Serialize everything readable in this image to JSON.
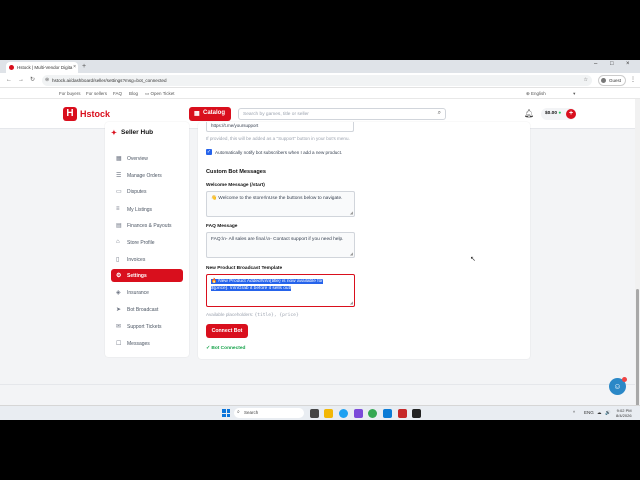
{
  "browser": {
    "tab_title": "Hstock | Multi-Vendor Digita",
    "tab_close": "×",
    "new_tab": "+",
    "window_controls": [
      "–",
      "□",
      "×"
    ],
    "url": "hstock.ai/dashboard/seller/settings?msg=bot_connected",
    "profile": "Guest",
    "bookmarks": [
      "For buyers",
      "For sellers",
      "FAQ",
      "Blog",
      "Open Ticket"
    ],
    "language": "English"
  },
  "header": {
    "logo_mark": "H",
    "logo_text": "Hstock",
    "catalog_label": "Catalog",
    "search_placeholder": "Search by games, title or seller",
    "wallet_amount": "$0.00",
    "wallet_plus": "+"
  },
  "sidebar": {
    "title": "Seller Hub",
    "items": [
      {
        "label": "Overview",
        "icon": "grid-icon"
      },
      {
        "label": "Manage Orders",
        "icon": "orders-icon"
      },
      {
        "label": "Disputes",
        "icon": "disputes-icon"
      },
      {
        "label": "My Listings",
        "icon": "listings-icon"
      },
      {
        "label": "Finances & Payouts",
        "icon": "finance-icon"
      },
      {
        "label": "Store Profile",
        "icon": "store-icon"
      },
      {
        "label": "Invoices",
        "icon": "invoice-icon"
      },
      {
        "label": "Settings",
        "icon": "gear-icon"
      },
      {
        "label": "Insurance",
        "icon": "shield-icon"
      },
      {
        "label": "Bot Broadcast",
        "icon": "broadcast-icon"
      },
      {
        "label": "Support Tickets",
        "icon": "ticket-icon"
      },
      {
        "label": "Messages",
        "icon": "chat-icon"
      }
    ]
  },
  "settings": {
    "support_url_value": "https://t.me/yoursupport",
    "support_url_hint": "If provided, this will be added as a \"Support\" button in your bot's menu.",
    "auto_notify_label": "Automatically notify bot subscribers when I add a new product.",
    "custom_messages_title": "Custom Bot Messages",
    "welcome_label": "Welcome Message (/start)",
    "welcome_value": "👋 Welcome to the store!\\nUse the buttons below to navigate.",
    "faq_label": "FAQ Message",
    "faq_value": "FAQ:\\n- All sales are final.\\n- Contact support if you need help.",
    "broadcast_label": "New Product Broadcast Template",
    "broadcast_line1": "🔥 New Product Added!\\n\\n{title} is now available for",
    "broadcast_line2": "${price}. \\n\\nGrab it before it sells out!",
    "placeholders_label": "Available placeholders:",
    "placeholders_value": "{title}, {price}",
    "connect_button": "Connect Bot",
    "status": "✓ Bot Connected"
  },
  "taskbar": {
    "search_placeholder": "Search",
    "tray": [
      "^",
      "ENG",
      "☁",
      "🔊",
      "🔋"
    ],
    "time": "9:02 PM",
    "date": "8/4/2026"
  },
  "colors": {
    "brand": "#d90f1d",
    "link_blue": "#2563eb",
    "success": "#16a34a"
  }
}
